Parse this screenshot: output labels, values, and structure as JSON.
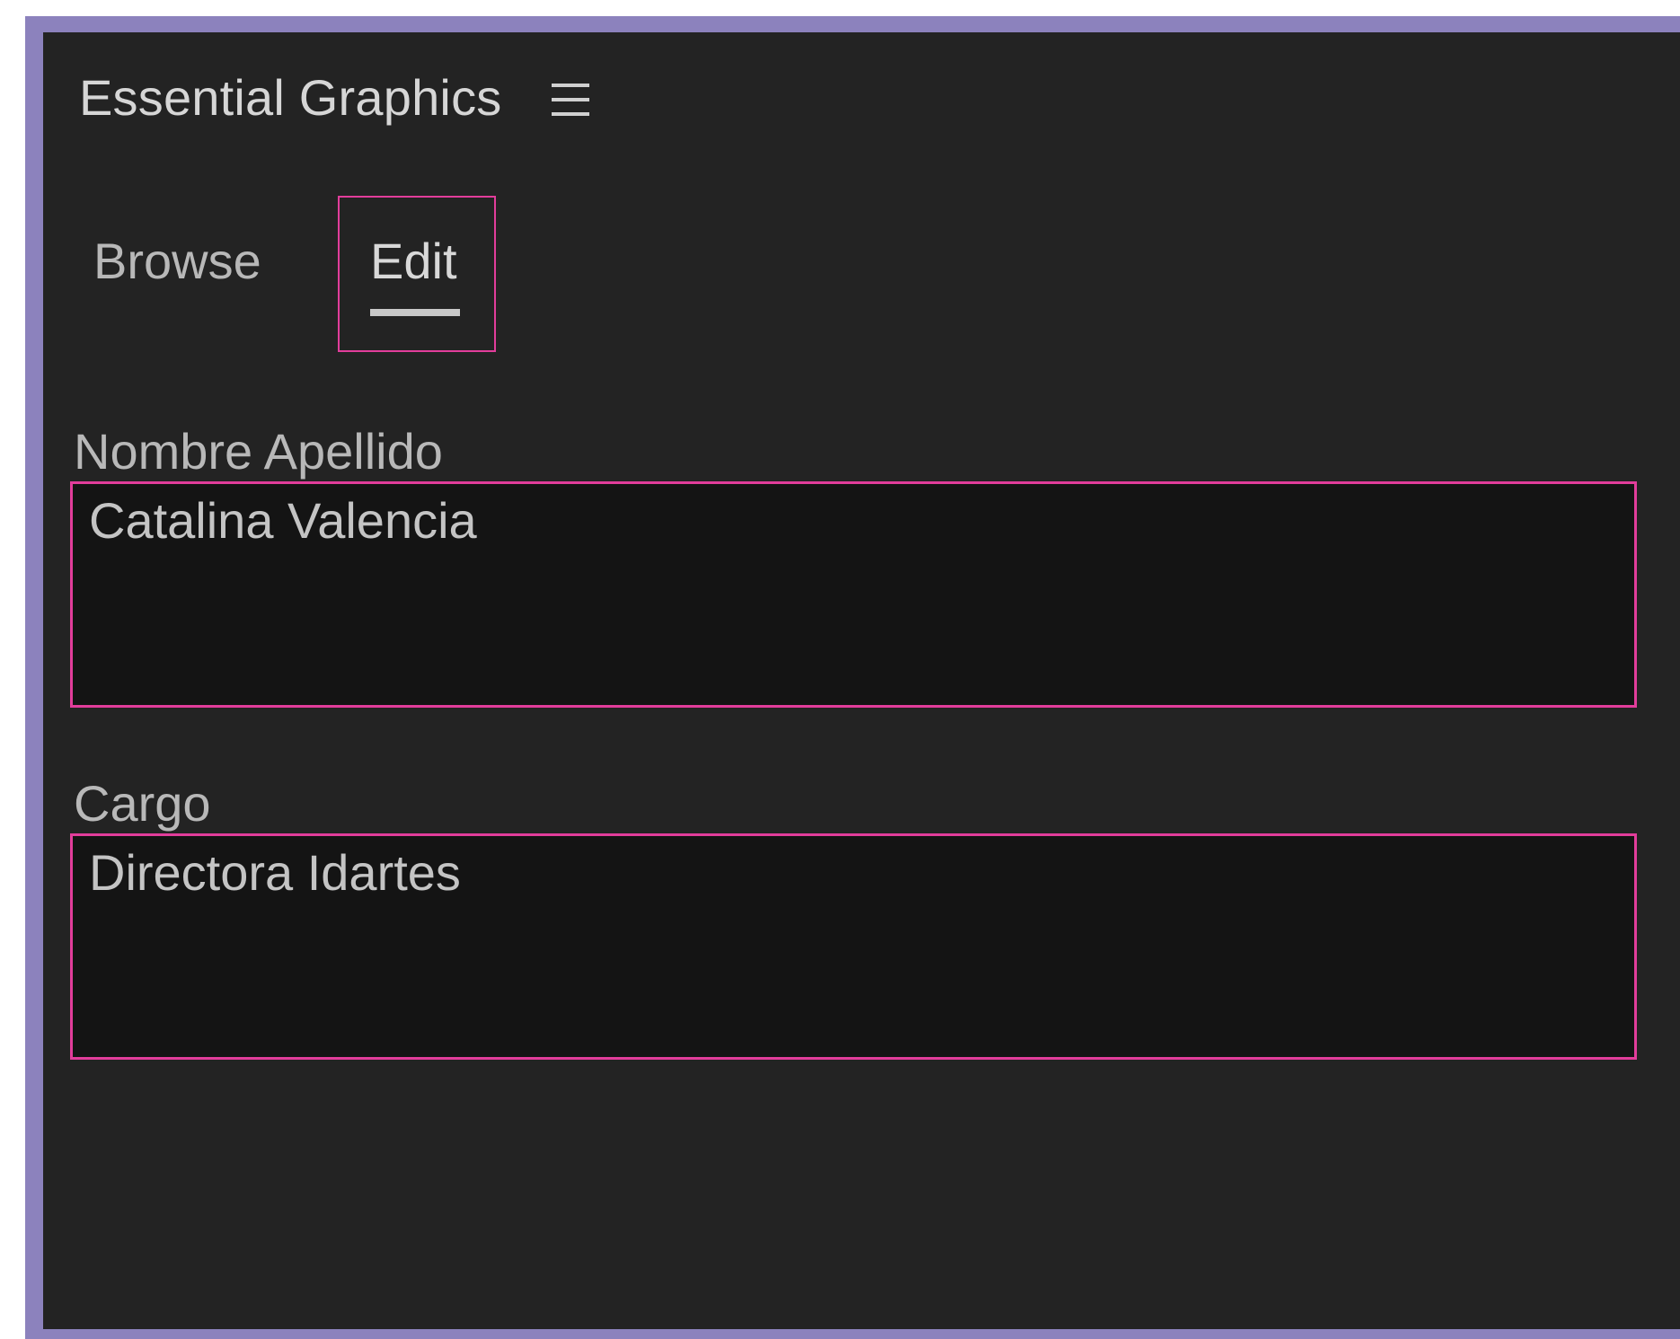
{
  "panel": {
    "title": "Essential Graphics",
    "menu_icon": "hamburger-menu-icon"
  },
  "tabs": [
    {
      "label": "Browse",
      "active": false
    },
    {
      "label": "Edit",
      "active": true
    }
  ],
  "fields": [
    {
      "label": "Nombre Apellido",
      "value": "Catalina Valencia"
    },
    {
      "label": "Cargo",
      "value": "Directora Idartes"
    }
  ],
  "colors": {
    "panel_background": "#232323",
    "field_background": "#141414",
    "highlight_border": "#e23d9b",
    "frame_border": "#8c82bd"
  }
}
